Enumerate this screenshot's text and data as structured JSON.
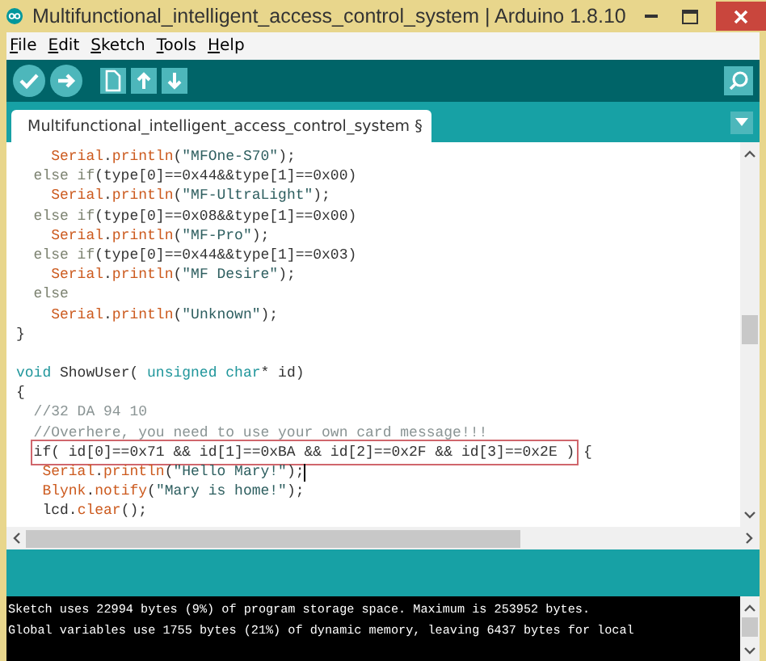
{
  "window": {
    "title": "Multifunctional_intelligent_access_control_system | Arduino 1.8.10"
  },
  "menu": [
    "File",
    "Edit",
    "Sketch",
    "Tools",
    "Help"
  ],
  "toolbar": [
    {
      "kind": "verify"
    },
    {
      "kind": "upload"
    },
    {
      "kind": "new"
    },
    {
      "kind": "open"
    },
    {
      "kind": "save"
    }
  ],
  "tabs": [
    {
      "label": "Multifunctional_intelligent_access_control_system §",
      "selected": true
    }
  ],
  "editor": {
    "lines": [
      {
        "segments": [
          {
            "text": "    Serial",
            "kind": "fn"
          },
          {
            "text": ".",
            "kind": "plain"
          },
          {
            "text": "println",
            "kind": "fn"
          },
          {
            "text": "(",
            "kind": "plain"
          },
          {
            "text": "\"MFOne-S70\"",
            "kind": "str"
          },
          {
            "text": ");",
            "kind": "plain"
          }
        ]
      },
      {
        "segments": [
          {
            "text": "  else if",
            "kind": "kw"
          },
          {
            "text": "(type[0]==0x44&&type[1]==0x00)",
            "kind": "plain"
          }
        ]
      },
      {
        "segments": [
          {
            "text": "    Serial",
            "kind": "fn"
          },
          {
            "text": ".",
            "kind": "plain"
          },
          {
            "text": "println",
            "kind": "fn"
          },
          {
            "text": "(",
            "kind": "plain"
          },
          {
            "text": "\"MF-UltraLight\"",
            "kind": "str"
          },
          {
            "text": ");",
            "kind": "plain"
          }
        ]
      },
      {
        "segments": [
          {
            "text": "  else if",
            "kind": "kw"
          },
          {
            "text": "(type[0]==0x08&&type[1]==0x00)",
            "kind": "plain"
          }
        ]
      },
      {
        "segments": [
          {
            "text": "    Serial",
            "kind": "fn"
          },
          {
            "text": ".",
            "kind": "plain"
          },
          {
            "text": "println",
            "kind": "fn"
          },
          {
            "text": "(",
            "kind": "plain"
          },
          {
            "text": "\"MF-Pro\"",
            "kind": "str"
          },
          {
            "text": ");",
            "kind": "plain"
          }
        ]
      },
      {
        "segments": [
          {
            "text": "  else if",
            "kind": "kw"
          },
          {
            "text": "(type[0]==0x44&&type[1]==0x03)",
            "kind": "plain"
          }
        ]
      },
      {
        "segments": [
          {
            "text": "    Serial",
            "kind": "fn"
          },
          {
            "text": ".",
            "kind": "plain"
          },
          {
            "text": "println",
            "kind": "fn"
          },
          {
            "text": "(",
            "kind": "plain"
          },
          {
            "text": "\"MF Desire\"",
            "kind": "str"
          },
          {
            "text": ");",
            "kind": "plain"
          }
        ]
      },
      {
        "segments": [
          {
            "text": "  else",
            "kind": "kw"
          }
        ]
      },
      {
        "segments": [
          {
            "text": "    Serial",
            "kind": "fn"
          },
          {
            "text": ".",
            "kind": "plain"
          },
          {
            "text": "println",
            "kind": "fn"
          },
          {
            "text": "(",
            "kind": "plain"
          },
          {
            "text": "\"Unknown\"",
            "kind": "str"
          },
          {
            "text": ");",
            "kind": "plain"
          }
        ]
      },
      {
        "segments": [
          {
            "text": "}",
            "kind": "plain"
          }
        ]
      },
      {
        "kind": "blank"
      },
      {
        "segments": [
          {
            "text": "void",
            "kind": "type"
          },
          {
            "text": " ShowUser( ",
            "kind": "plain"
          },
          {
            "text": "unsigned char",
            "kind": "type"
          },
          {
            "text": "* id)",
            "kind": "plain"
          }
        ]
      },
      {
        "segments": [
          {
            "text": "{",
            "kind": "plain"
          }
        ]
      },
      {
        "segments": [
          {
            "text": "  //32 DA 94 10",
            "kind": "comment"
          }
        ]
      },
      {
        "segments": [
          {
            "text": "  //Overhere, you need to use your own card message!!!",
            "kind": "comment"
          }
        ]
      },
      {
        "segments": [
          {
            "text": "  if( id[0]==0x71 && id[1]==0xBA && id[2]==0x2F && id[3]==0x2E )",
            "kind": "plain",
            "boxed": true
          },
          {
            "text": " {",
            "kind": "plain"
          }
        ]
      },
      {
        "cursor": true,
        "segments": [
          {
            "text": "   Serial",
            "kind": "fn"
          },
          {
            "text": ".",
            "kind": "plain"
          },
          {
            "text": "println",
            "kind": "fn"
          },
          {
            "text": "(",
            "kind": "plain"
          },
          {
            "text": "\"Hello Mary!\"",
            "kind": "str"
          },
          {
            "text": ");",
            "kind": "plain"
          }
        ]
      },
      {
        "segments": [
          {
            "text": "   Blynk",
            "kind": "fn"
          },
          {
            "text": ".",
            "kind": "plain"
          },
          {
            "text": "notify",
            "kind": "fn"
          },
          {
            "text": "(",
            "kind": "plain"
          },
          {
            "text": "\"Mary is home!\"",
            "kind": "str"
          },
          {
            "text": ");",
            "kind": "plain"
          }
        ]
      },
      {
        "segments": [
          {
            "text": "   lcd.",
            "kind": "plain"
          },
          {
            "text": "clear",
            "kind": "fn"
          },
          {
            "text": "();",
            "kind": "plain"
          }
        ]
      }
    ]
  },
  "console": {
    "lines": [
      "Sketch uses 22994 bytes (9%) of program storage space. Maximum is 253952 bytes.",
      "Global variables use 1755 bytes (21%) of dynamic memory, leaving 6437 bytes for local"
    ]
  }
}
